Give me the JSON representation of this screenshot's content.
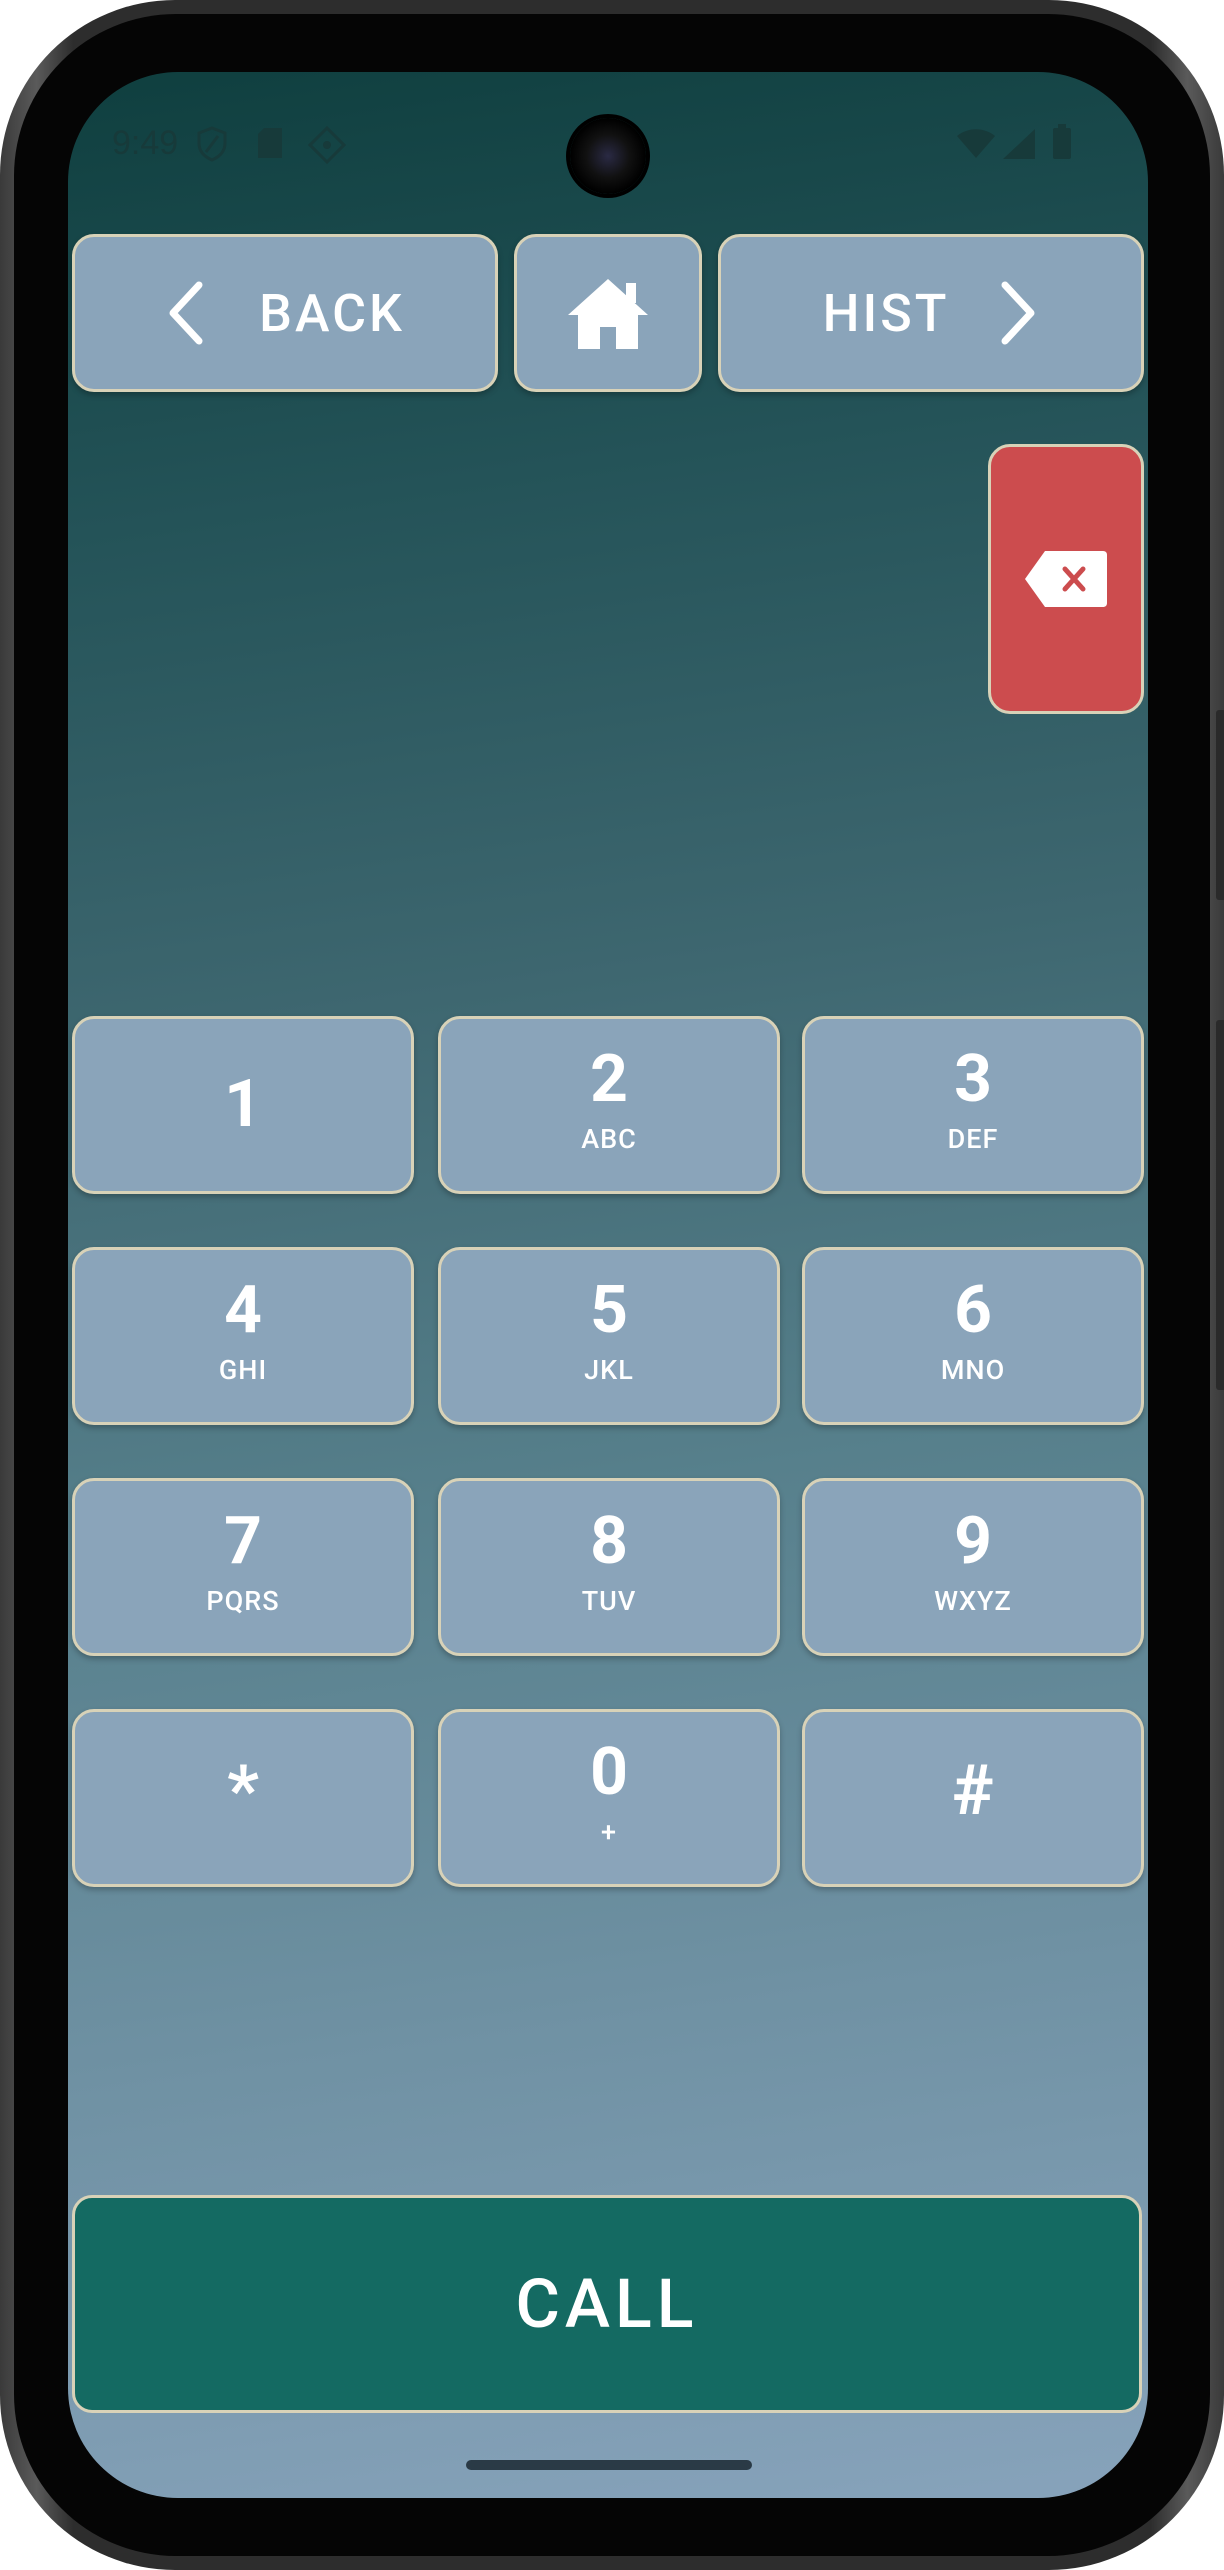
{
  "status_bar": {
    "time": "9:49",
    "icons": [
      "shield-icon",
      "sd-card-icon",
      "location-diamond-icon",
      "wifi-icon",
      "signal-icon",
      "battery-icon"
    ]
  },
  "nav": {
    "back_label": "BACK",
    "home_icon": "home-icon",
    "hist_label": "HIST"
  },
  "display": {
    "number": ""
  },
  "keypad": [
    {
      "digit": "1",
      "letters": ""
    },
    {
      "digit": "2",
      "letters": "ABC"
    },
    {
      "digit": "3",
      "letters": "DEF"
    },
    {
      "digit": "4",
      "letters": "GHI"
    },
    {
      "digit": "5",
      "letters": "JKL"
    },
    {
      "digit": "6",
      "letters": "MNO"
    },
    {
      "digit": "7",
      "letters": "PQRS"
    },
    {
      "digit": "8",
      "letters": "TUV"
    },
    {
      "digit": "9",
      "letters": "WXYZ"
    },
    {
      "digit": "*",
      "letters": ""
    },
    {
      "digit": "0",
      "letters": "+"
    },
    {
      "digit": "#",
      "letters": ""
    }
  ],
  "call_label": "CALL",
  "colors": {
    "key_bg": "#8aa4ba",
    "key_border": "#d8d2b8",
    "backspace_bg": "#cc4c4e",
    "call_bg": "#146a62"
  }
}
